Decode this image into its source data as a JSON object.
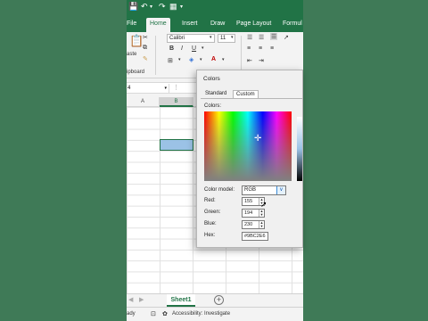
{
  "ribbon": {
    "tabs": [
      "File",
      "Home",
      "Insert",
      "Draw",
      "Page Layout",
      "Formul"
    ],
    "active_tab": "Home",
    "paste_label": "aste",
    "clipboard_label": "ipboard",
    "font_name": "Calibri",
    "font_size": "11",
    "bold_icon": "B",
    "italic_icon": "I",
    "underline_icon": "U"
  },
  "namebox": {
    "value": "4"
  },
  "grid": {
    "columns": [
      "A",
      "B"
    ],
    "selected_column": "B"
  },
  "sheets": {
    "tabs": [
      "Sheet1"
    ],
    "add_icon": "+"
  },
  "status": {
    "ready": "ady",
    "accessibility": "Accessibility: Investigate"
  },
  "dialog": {
    "title": "Colors",
    "tabs": [
      "Standard",
      "Custom"
    ],
    "active_tab": "Custom",
    "colors_label": "Colors:",
    "color_model_label": "Color model:",
    "color_model_value": "RGB",
    "red_label": "Red:",
    "red_value": "155",
    "green_label": "Green:",
    "green_value": "194",
    "blue_label": "Blue:",
    "blue_value": "230",
    "hex_label": "Hex:",
    "hex_value": "#9BC2E6"
  },
  "colors": {
    "excel_green": "#217346",
    "background": "#3f7a57",
    "selected_fill": "#9bc2e6"
  }
}
